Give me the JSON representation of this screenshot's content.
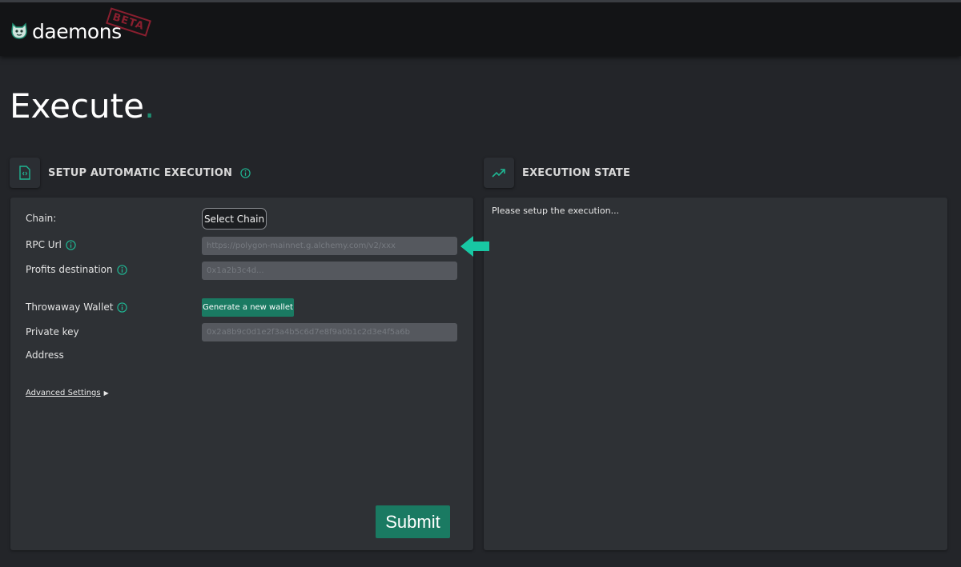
{
  "app": {
    "name": "daemons",
    "badge": "BETA"
  },
  "page": {
    "title": "Execute",
    "title_dot": "."
  },
  "setup": {
    "heading": "SETUP AUTOMATIC EXECUTION",
    "chain": {
      "label": "Chain:",
      "button": "Select Chain"
    },
    "rpc": {
      "label": "RPC Url",
      "placeholder": "https://polygon-mainnet.g.alchemy.com/v2/xxx"
    },
    "profits": {
      "label": "Profits destination",
      "placeholder": "0x1a2b3c4d..."
    },
    "wallet": {
      "label": "Throwaway Wallet",
      "button": "Generate a new wallet"
    },
    "private_key": {
      "label": "Private key",
      "placeholder": "0x2a8b9c0d1e2f3a4b5c6d7e8f9a0b1c2d3e4f5a6b"
    },
    "address": {
      "label": "Address"
    },
    "advanced": {
      "label": "Advanced Settings",
      "arrow": "▶"
    },
    "submit": "Submit"
  },
  "state": {
    "heading": "EXECUTION STATE",
    "message": "Please setup the execution..."
  },
  "colors": {
    "accent": "#1a7a62",
    "accent_bright": "#18c7a3",
    "background": "#232529",
    "panel": "#2e3135",
    "topbar": "#131416",
    "beta": "#8a1f2f"
  },
  "icons": {
    "logo": "daemon-head-icon",
    "setup": "contract-file-icon",
    "state": "trending-up-icon",
    "info": "info-icon",
    "pointer": "arrow-left-icon"
  }
}
